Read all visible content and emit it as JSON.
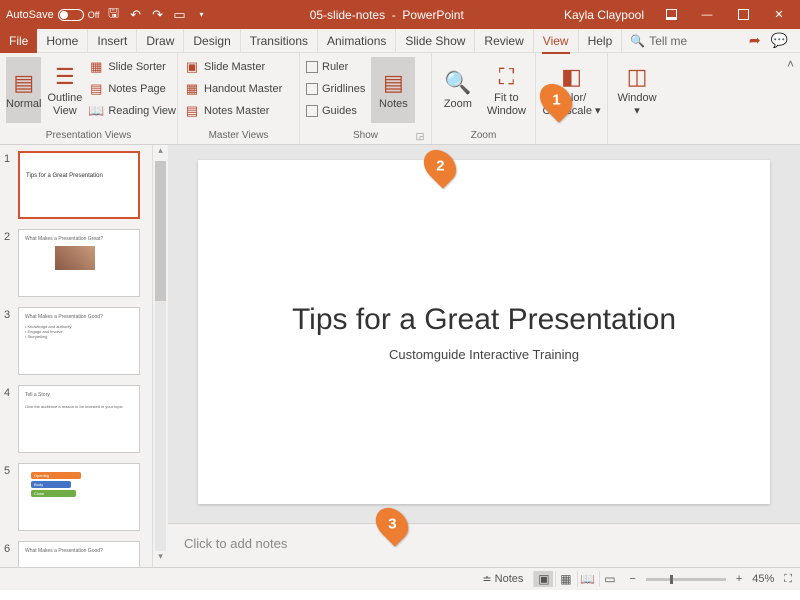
{
  "titlebar": {
    "autosave_label": "AutoSave",
    "autosave_state": "Off",
    "doc_name": "05-slide-notes",
    "app_name": "PowerPoint",
    "user": "Kayla Claypool"
  },
  "menu": {
    "tabs": [
      "File",
      "Home",
      "Insert",
      "Draw",
      "Design",
      "Transitions",
      "Animations",
      "Slide Show",
      "Review",
      "View",
      "Help"
    ],
    "active_index": 9,
    "tell_me": "Tell me"
  },
  "ribbon": {
    "groups": {
      "presentation_views": {
        "label": "Presentation Views",
        "normal": "Normal",
        "outline": "Outline View",
        "slide_sorter": "Slide Sorter",
        "notes_page": "Notes Page",
        "reading_view": "Reading View"
      },
      "master_views": {
        "label": "Master Views",
        "slide_master": "Slide Master",
        "handout_master": "Handout Master",
        "notes_master": "Notes Master"
      },
      "show": {
        "label": "Show",
        "ruler": "Ruler",
        "gridlines": "Gridlines",
        "guides": "Guides",
        "notes": "Notes"
      },
      "zoom": {
        "label": "Zoom",
        "zoom": "Zoom",
        "fit": "Fit to Window"
      },
      "color": {
        "label": "Color/ Grayscale",
        "btn": "Color/\nGrayscale"
      },
      "window": {
        "label": "",
        "btn": "Window"
      }
    }
  },
  "slide": {
    "title": "Tips for a Great Presentation",
    "subtitle": "Customguide Interactive Training"
  },
  "notes_placeholder": "Click to add notes",
  "thumbs": [
    {
      "num": "1",
      "title": "Tips for a Great Presentation"
    },
    {
      "num": "2",
      "title": "What Makes a Presentation Great?"
    },
    {
      "num": "3",
      "title": "What Makes a Presentation Good?"
    },
    {
      "num": "4",
      "title": "Tell a Story"
    },
    {
      "num": "5",
      "title": ""
    },
    {
      "num": "6",
      "title": "What Makes a Presentation Good?"
    }
  ],
  "statusbar": {
    "notes": "Notes",
    "zoom_pct": "45%"
  },
  "callouts": {
    "c1": "1",
    "c2": "2",
    "c3": "3"
  }
}
